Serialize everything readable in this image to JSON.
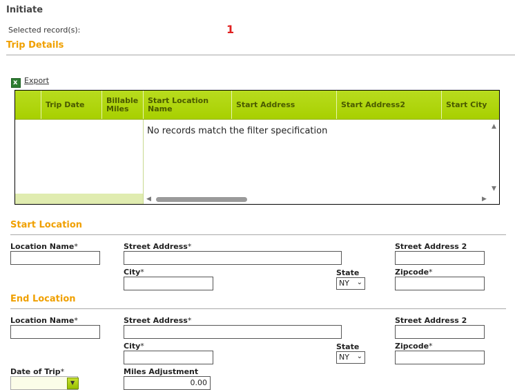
{
  "page": {
    "heading": "Initiate",
    "selected_label": "Selected record(s):",
    "selected_count": "1"
  },
  "trip_details": {
    "title": "Trip Details",
    "export_label": "Export",
    "columns": [
      "",
      "Trip Date",
      "Billable Miles",
      "Start Location Name",
      "Start Address",
      "Start Address2",
      "Start City"
    ],
    "empty_message": "No records match the filter specification"
  },
  "start_location": {
    "title": "Start Location",
    "location_name_label": "Location Name",
    "street_address_label": "Street Address",
    "street_address2_label": "Street Address 2",
    "city_label": "City",
    "state_label": "State",
    "state_value": "NY",
    "zipcode_label": "Zipcode",
    "required_mark": "*"
  },
  "end_location": {
    "title": "End Location",
    "location_name_label": "Location Name",
    "street_address_label": "Street Address",
    "street_address2_label": "Street Address 2",
    "city_label": "City",
    "state_label": "State",
    "state_value": "NY",
    "zipcode_label": "Zipcode",
    "required_mark": "*"
  },
  "trip": {
    "date_label": "Date of Trip",
    "required_mark": "*",
    "miles_adjustment_label": "Miles Adjustment",
    "miles_adjustment_value": "0.00"
  },
  "colors": {
    "accent": "#f0a000",
    "grid_header": "#a8d000",
    "count_red": "#e02020"
  },
  "icons": {
    "export": "excel-icon",
    "state_dropdown": "chevron-down-icon",
    "date_picker": "calendar-dropdown-icon"
  }
}
